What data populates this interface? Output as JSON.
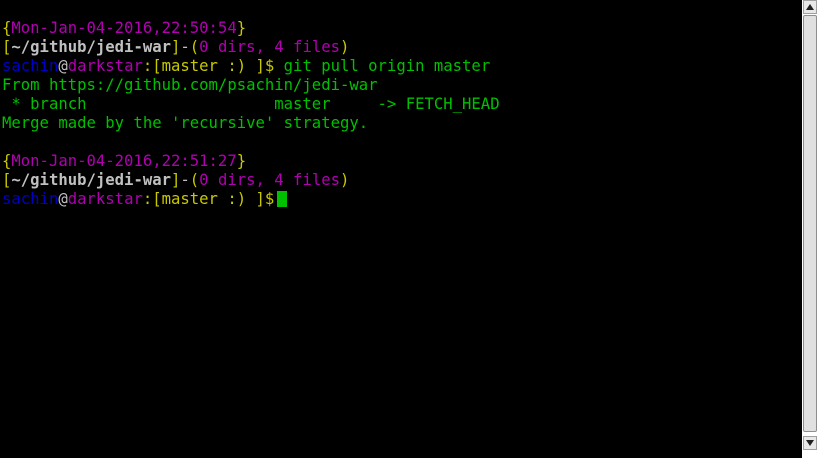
{
  "colors": {
    "background": "#000000",
    "magenta": "#b000b0",
    "yellow": "#c8c800",
    "green": "#00c000",
    "blue": "#0000c8",
    "white": "#c0c0c0"
  },
  "terminal": {
    "block1": {
      "ts_open": "{",
      "timestamp": "Mon-Jan-04-2016,22:50:54",
      "ts_close": "}",
      "path_open": "[",
      "path": "~/github/jedi-war",
      "path_close": "]",
      "dash": "-",
      "dirinfo_open": "(",
      "dirinfo": "0 dirs, 4 files",
      "dirinfo_close": ")",
      "user": "sachin",
      "at": "@",
      "host": "darkstar",
      "branch_part": ":[master :) ]$",
      "command": " git pull origin master"
    },
    "output": {
      "from": "From https://github.com/psachin/jedi-war",
      "branch_line": " * branch                    master     -> FETCH_HEAD",
      "merge": "Merge made by the 'recursive' strategy."
    },
    "block2": {
      "ts_open": "{",
      "timestamp": "Mon-Jan-04-2016,22:51:27",
      "ts_close": "}",
      "path_open": "[",
      "path": "~/github/jedi-war",
      "path_close": "]",
      "dash": "-",
      "dirinfo_open": "(",
      "dirinfo": "0 dirs, 4 files",
      "dirinfo_close": ")",
      "user": "sachin",
      "at": "@",
      "host": "darkstar",
      "branch_part": ":[master :) ]$"
    }
  },
  "scrollbar": {
    "up_icon": "▲",
    "down_icon": "▼"
  }
}
